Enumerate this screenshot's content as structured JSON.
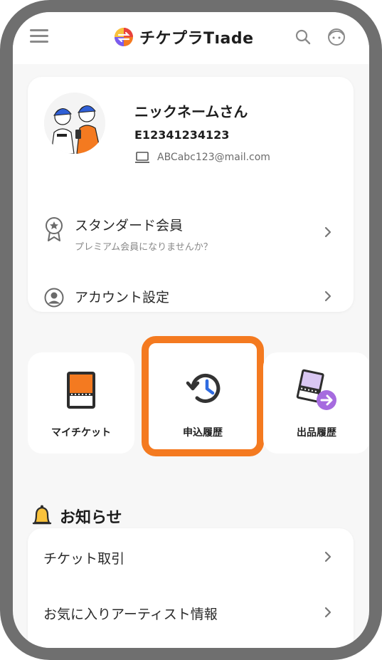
{
  "header": {
    "logo_text": "チケプラTıade",
    "menu_icon": "hamburger-icon",
    "search_icon": "search-icon",
    "account_icon": "face-icon"
  },
  "profile": {
    "nickname": "ニックネームさん",
    "member_id": "E12341234123",
    "email": "ABCabc123@mail.com",
    "email_icon": "laptop-icon"
  },
  "membership": {
    "title": "スタンダード会員",
    "subtitle": "プレミアム会員になりませんか？",
    "icon": "award-badge-icon"
  },
  "account_settings": {
    "title": "アカウント設定",
    "icon": "user-circle-icon"
  },
  "tiles": [
    {
      "label": "マイチケット",
      "icon": "ticket-icon"
    },
    {
      "label": "申込履歴",
      "icon": "history-icon"
    },
    {
      "label": "出品履歴",
      "icon": "listing-history-icon"
    }
  ],
  "news": {
    "title": "お知らせ",
    "icon": "bell-icon",
    "items": [
      {
        "label": "チケット取引"
      },
      {
        "label": "お気に入りアーティスト情報"
      }
    ]
  },
  "colors": {
    "accent_orange": "#f47a20",
    "purple": "#a66bdf",
    "lavender": "#d9c7f2",
    "dark": "#2d2d2d",
    "frame": "#6f6f6f"
  }
}
